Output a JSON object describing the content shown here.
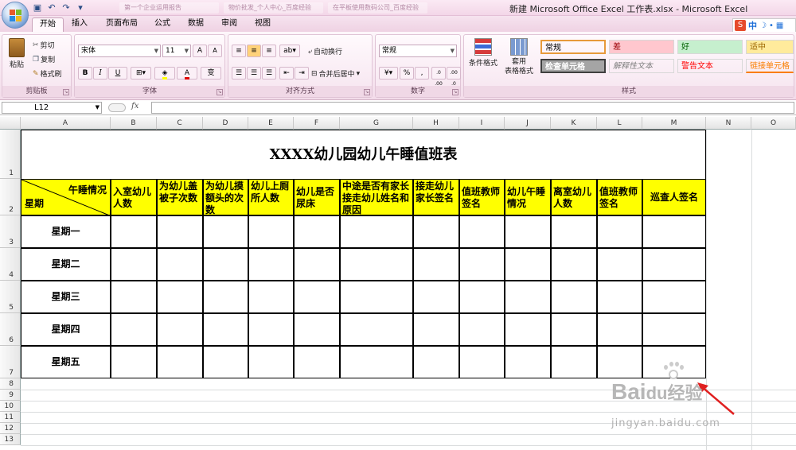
{
  "window": {
    "title": "新建 Microsoft Office Excel 工作表.xlsx - Microsoft Excel",
    "doc_tabs": [
      "第一个企业运用报告",
      "物价批发_个人中心_百度经验",
      "在平板使用数码公司_百度经验"
    ]
  },
  "tabs": [
    {
      "label": "开始",
      "active": true
    },
    {
      "label": "插入"
    },
    {
      "label": "页面布局"
    },
    {
      "label": "公式"
    },
    {
      "label": "数据"
    },
    {
      "label": "审阅"
    },
    {
      "label": "视图"
    }
  ],
  "ime": {
    "label": "中"
  },
  "ribbon": {
    "clipboard": {
      "label": "剪贴板",
      "paste": "粘贴",
      "cut": "剪切",
      "copy": "复制",
      "format_painter": "格式刷"
    },
    "font": {
      "label": "字体",
      "name": "宋体",
      "size": "11",
      "grow": "A",
      "shrink": "A",
      "bold": "B",
      "italic": "I",
      "underline": "U",
      "font_color": "A",
      "phonetic": "变"
    },
    "alignment": {
      "label": "对齐方式",
      "wrap": "自动换行",
      "merge": "合并后居中"
    },
    "number": {
      "label": "数字",
      "format": "常规",
      "percent": "%",
      "comma": ",",
      "inc_decimal": ".0 .00",
      "dec_decimal": ".00 .0"
    },
    "styles": {
      "label": "样式",
      "conditional": "条件格式",
      "table_format": "套用\n表格格式",
      "cells": [
        {
          "label": "常规",
          "bg": "#ffffff",
          "fg": "#000000"
        },
        {
          "label": "差",
          "bg": "#ffc7ce",
          "fg": "#9c0006"
        },
        {
          "label": "好",
          "bg": "#c6efce",
          "fg": "#006100"
        },
        {
          "label": "适中",
          "bg": "#ffeb9c",
          "fg": "#9c6500"
        },
        {
          "label": "检查单元格",
          "bg": "#a5a5a5",
          "fg": "#ffffff"
        },
        {
          "label": "解释性文本",
          "bg": "#ffffff",
          "fg": "#7f7f7f"
        },
        {
          "label": "警告文本",
          "bg": "#ffffff",
          "fg": "#ff0000"
        },
        {
          "label": "链接单元格",
          "bg": "#ffffff",
          "fg": "#fa7d00"
        }
      ]
    }
  },
  "formula_bar": {
    "name_box": "L12",
    "fx": "fx",
    "value": ""
  },
  "columns": [
    "A",
    "B",
    "C",
    "D",
    "E",
    "F",
    "G",
    "H",
    "I",
    "J",
    "K",
    "L",
    "M",
    "N",
    "O"
  ],
  "rows": [
    "1",
    "2",
    "3",
    "4",
    "5",
    "6",
    "7",
    "8",
    "9",
    "10",
    "11",
    "12",
    "13"
  ],
  "sheet": {
    "title": "XXXX幼儿园幼儿午睡值班表",
    "diag_top": "午睡情况",
    "diag_bottom": "星期",
    "headers": [
      "入室幼儿人数",
      "为幼儿盖被子次数",
      "为幼儿摸额头的次数",
      "幼儿上厕所人数",
      "幼儿是否尿床",
      "中途是否有家长接走幼儿姓名和原因",
      "接走幼儿家长签名",
      "值班教师签名",
      "幼儿午睡情况",
      "离室幼儿人数",
      "值班教师签名",
      "巡查人签名"
    ],
    "days": [
      "星期一",
      "星期二",
      "星期三",
      "星期四",
      "星期五"
    ]
  },
  "watermark": {
    "brand": "Bai",
    "brand2": "du",
    "suffix": "经验",
    "url": "jingyan.baidu.com"
  },
  "colors": {
    "header_yellow": "#ffff00",
    "ribbon_pink": "#f3dcea",
    "arrow_red": "#e02020"
  }
}
